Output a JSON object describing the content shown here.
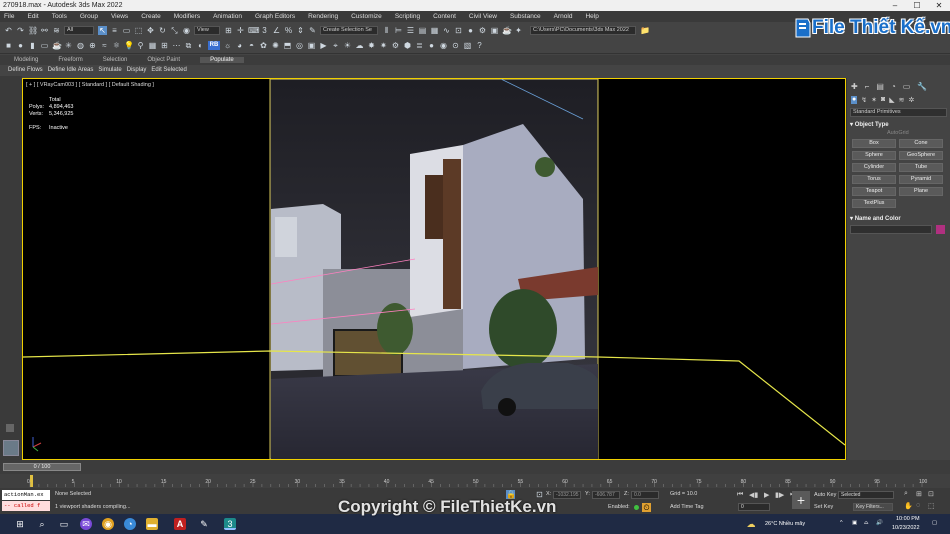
{
  "window": {
    "title": "270918.max - Autodesk 3ds Max 2022",
    "controls": [
      "–",
      "☐",
      "✕"
    ]
  },
  "menu": [
    "File",
    "Edit",
    "Tools",
    "Group",
    "Views",
    "Create",
    "Modifiers",
    "Animation",
    "Graph Editors",
    "Rendering",
    "Customize",
    "Scripting",
    "Content",
    "Civil View",
    "Substance",
    "Arnold",
    "Help"
  ],
  "toolbar": {
    "selection_filter": "All",
    "ref_coord": "View",
    "selection_set": "Create Selection Se",
    "project_path": "C:\\Users\\PC\\Documents\\3ds Max 2022",
    "rb_label": "RB"
  },
  "ribbon": {
    "tabs": [
      "Modeling",
      "Freeform",
      "Selection",
      "Object Paint",
      "Populate"
    ],
    "active": "Populate"
  },
  "subribbon": [
    "Define Flows",
    "Define Idle Areas",
    "Simulate",
    "Display",
    "Edit Selected"
  ],
  "viewport": {
    "label": "[ + ] [ VRayCam003 ] [ Standard ] [ Default Shading ]",
    "stats": {
      "total_label": "Total",
      "polys_label": "Polys:",
      "polys_value": "4,894,463",
      "verts_label": "Verts:",
      "verts_value": "5,346,925",
      "fps_label": "FPS:",
      "fps_value": "Inactive"
    }
  },
  "command_panel": {
    "dropdown": "Standard Primitives",
    "object_type_title": "Object Type",
    "autogrid": "AutoGrid",
    "buttons": [
      "Box",
      "Cone",
      "Sphere",
      "GeoSphere",
      "Cylinder",
      "Tube",
      "Torus",
      "Pyramid",
      "Teapot",
      "Plane",
      "TextPlus"
    ],
    "name_color_title": "Name and Color",
    "object_color": "#b03080"
  },
  "timeline": {
    "frame_display": "0 / 100",
    "ticks": [
      "0",
      "5",
      "10",
      "15",
      "20",
      "25",
      "30",
      "35",
      "40",
      "45",
      "50",
      "55",
      "60",
      "65",
      "70",
      "75",
      "80",
      "85",
      "90",
      "95",
      "100"
    ]
  },
  "status": {
    "maxscript_line1": "actionMan.ex",
    "maxscript_line2": "-- called f",
    "selection": "None Selected",
    "prompt": "1 viewport shaders compiling...",
    "x_label": "X:",
    "x_value": "-1032.195",
    "y_label": "Y:",
    "y_value": "-606.787",
    "z_label": "Z:",
    "z_value": "0.0",
    "grid": "Grid = 10.0",
    "enabled": "Enabled:",
    "add_time_tag": "Add Time Tag",
    "auto_key": "Auto Key",
    "set_key": "Set Key",
    "selected": "Selected",
    "key_filters": "Key Filters...",
    "frame": "0"
  },
  "taskbar": {
    "weather": "26°C  Nhiều mây",
    "time": "10:00 PM",
    "date": "10/23/2022"
  },
  "watermark": "Copyright © FileThietKe.vn",
  "logo": "File Thiết Kế.vn",
  "colors": {
    "viewport_border": "#f0d000",
    "logo_blue": "#1a6fc9",
    "maxscript_error": "#cc0000"
  }
}
